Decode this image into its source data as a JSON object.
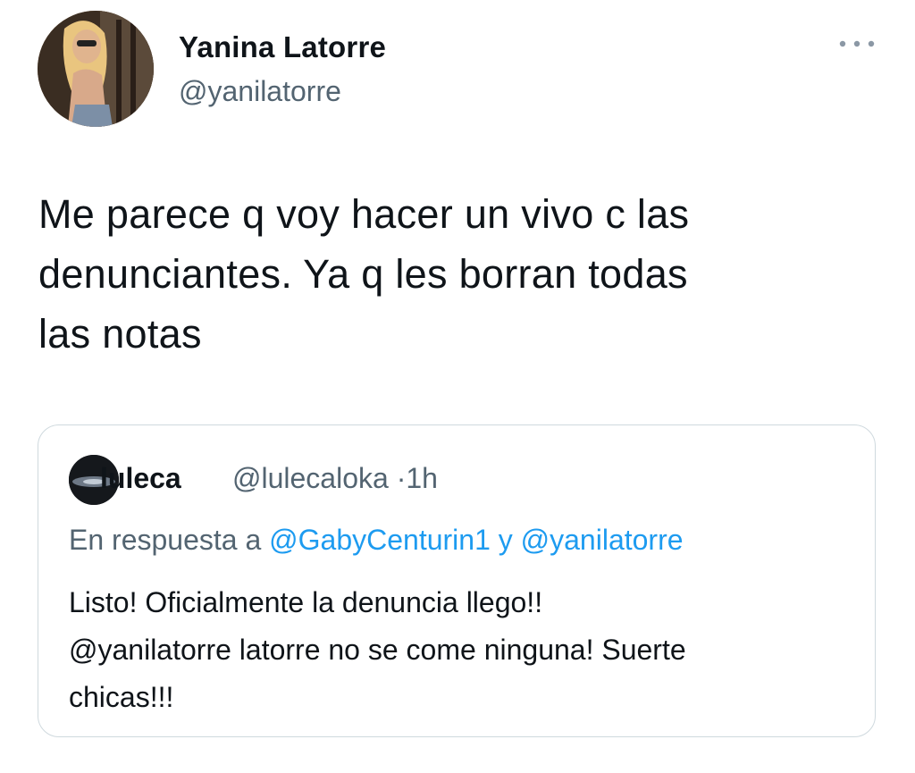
{
  "author": {
    "name": "Yanina Latorre",
    "handle": "@yanilatorre",
    "avatar_icon": "profile-photo"
  },
  "more_icon": "ellipsis-icon",
  "tweet": {
    "lines": [
      "Me parece q voy hacer un vivo c las",
      "denunciantes. Ya q les borran todas",
      "las notas"
    ]
  },
  "quoted_tweet": {
    "name": "luleca",
    "handle": "@lulecaloka",
    "separator": "·",
    "time": "1h",
    "reply_prefix": "En respuesta a",
    "reply_to_1": "@GabyCenturin1",
    "reply_conjunction": "y",
    "reply_to_2": "@yanilatorre",
    "text_line_1": "Listo! Oficialmente la denuncia llego!!",
    "text_line_2_mention": "@yanilatorre",
    "text_line_2_rest": "latorre no se come ninguna! Suerte",
    "text_line_3": "chicas!!!"
  },
  "colors": {
    "text_primary": "#0f1419",
    "text_secondary": "#536471",
    "link": "#1d9bf0",
    "border": "#cfd9de"
  }
}
